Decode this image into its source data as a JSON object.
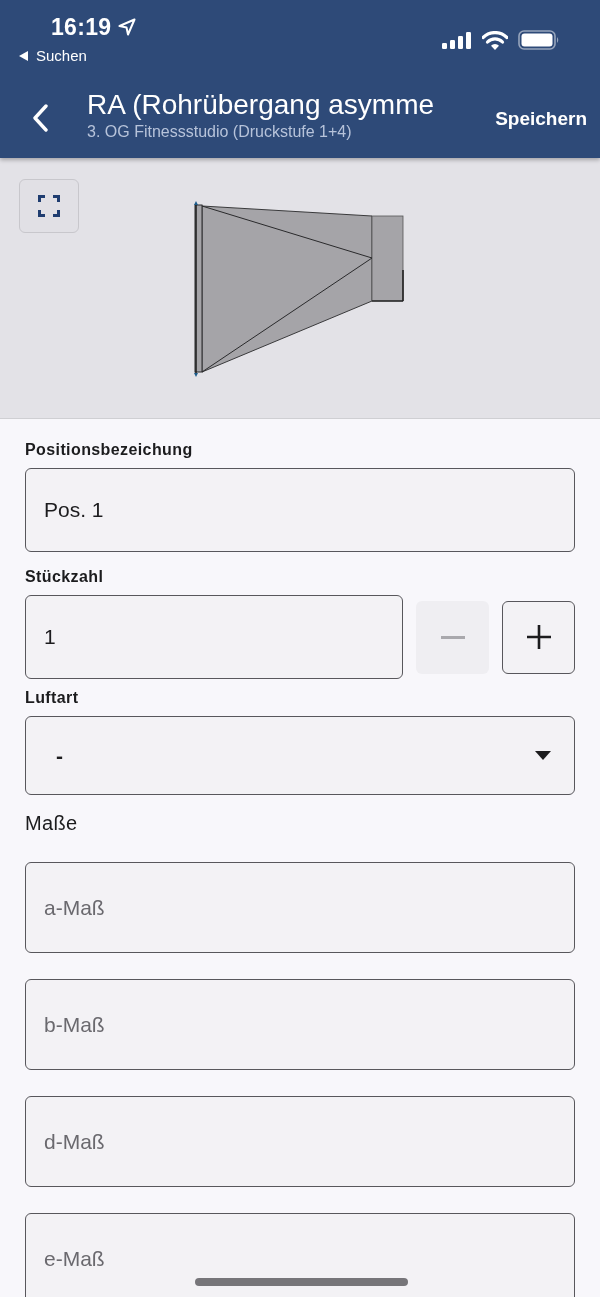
{
  "status_bar": {
    "time": "16:19",
    "back_link": "Suchen"
  },
  "nav_bar": {
    "title": "RA (Rohrübergang asymme",
    "subtitle": "3. OG Fitnessstudio (Druckstufe 1+4)",
    "action": "Speichern"
  },
  "form": {
    "fields": [
      {
        "kind": "text",
        "label": "Positionsbezeichung",
        "value": "Pos. 1"
      },
      {
        "kind": "stepper",
        "label": "Stückzahl",
        "value": "1",
        "decrement_disabled": true,
        "increment_disabled": false
      },
      {
        "kind": "select",
        "label": "Luftart",
        "value": "-"
      }
    ]
  },
  "dimensions": {
    "heading": "Maße",
    "fields": [
      {
        "placeholder": "a-Maß"
      },
      {
        "placeholder": "b-Maß"
      },
      {
        "placeholder": "d-Maß"
      },
      {
        "placeholder": "e-Maß"
      }
    ]
  }
}
